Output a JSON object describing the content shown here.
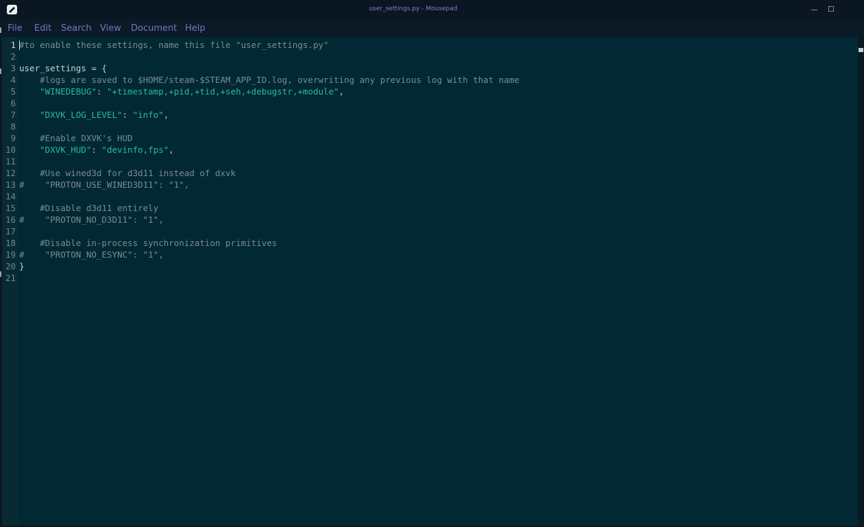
{
  "window": {
    "title": "user_settings.py - Mousepad"
  },
  "menu": [
    "File",
    "Edit",
    "Search",
    "View",
    "Document",
    "Help"
  ],
  "editor": {
    "current_line": 1,
    "lines": [
      {
        "num": "1",
        "spans": [
          {
            "t": "comment",
            "v": "#to enable these settings, name this file \"user_settings.py\""
          }
        ]
      },
      {
        "num": "2",
        "spans": []
      },
      {
        "num": "3",
        "spans": [
          {
            "t": "ident",
            "v": "user_settings = {"
          }
        ]
      },
      {
        "num": "4",
        "spans": [
          {
            "t": "comment",
            "v": "    #logs are saved to $HOME/steam-$STEAM_APP_ID.log, overwriting any previous log with that name"
          }
        ]
      },
      {
        "num": "5",
        "spans": [
          {
            "t": "string",
            "v": "    \"WINEDEBUG\""
          },
          {
            "t": "text",
            "v": ": "
          },
          {
            "t": "string",
            "v": "\"+timestamp,+pid,+tid,+seh,+debugstr,+module\""
          },
          {
            "t": "text",
            "v": ","
          }
        ]
      },
      {
        "num": "6",
        "spans": []
      },
      {
        "num": "7",
        "spans": [
          {
            "t": "string",
            "v": "    \"DXVK_LOG_LEVEL\""
          },
          {
            "t": "text",
            "v": ": "
          },
          {
            "t": "string",
            "v": "\"info\""
          },
          {
            "t": "text",
            "v": ","
          }
        ]
      },
      {
        "num": "8",
        "spans": []
      },
      {
        "num": "9",
        "spans": [
          {
            "t": "comment",
            "v": "    #Enable DXVK's HUD"
          }
        ]
      },
      {
        "num": "10",
        "spans": [
          {
            "t": "string",
            "v": "    \"DXVK_HUD\""
          },
          {
            "t": "text",
            "v": ": "
          },
          {
            "t": "string",
            "v": "\"devinfo,fps\""
          },
          {
            "t": "text",
            "v": ","
          }
        ]
      },
      {
        "num": "11",
        "spans": []
      },
      {
        "num": "12",
        "spans": [
          {
            "t": "comment",
            "v": "    #Use wined3d for d3d11 instead of dxvk"
          }
        ]
      },
      {
        "num": "13",
        "spans": [
          {
            "t": "comment",
            "v": "#    \"PROTON_USE_WINED3D11\": \"1\","
          }
        ]
      },
      {
        "num": "14",
        "spans": []
      },
      {
        "num": "15",
        "spans": [
          {
            "t": "comment",
            "v": "    #Disable d3d11 entirely"
          }
        ]
      },
      {
        "num": "16",
        "spans": [
          {
            "t": "comment",
            "v": "#    \"PROTON_NO_D3D11\": \"1\","
          }
        ]
      },
      {
        "num": "17",
        "spans": []
      },
      {
        "num": "18",
        "spans": [
          {
            "t": "comment",
            "v": "    #Disable in-process synchronization primitives"
          }
        ]
      },
      {
        "num": "19",
        "spans": [
          {
            "t": "comment",
            "v": "#    \"PROTON_NO_ESYNC\": \"1\","
          }
        ]
      },
      {
        "num": "20",
        "spans": [
          {
            "t": "ident",
            "v": "}"
          }
        ]
      },
      {
        "num": "21",
        "spans": []
      }
    ]
  }
}
